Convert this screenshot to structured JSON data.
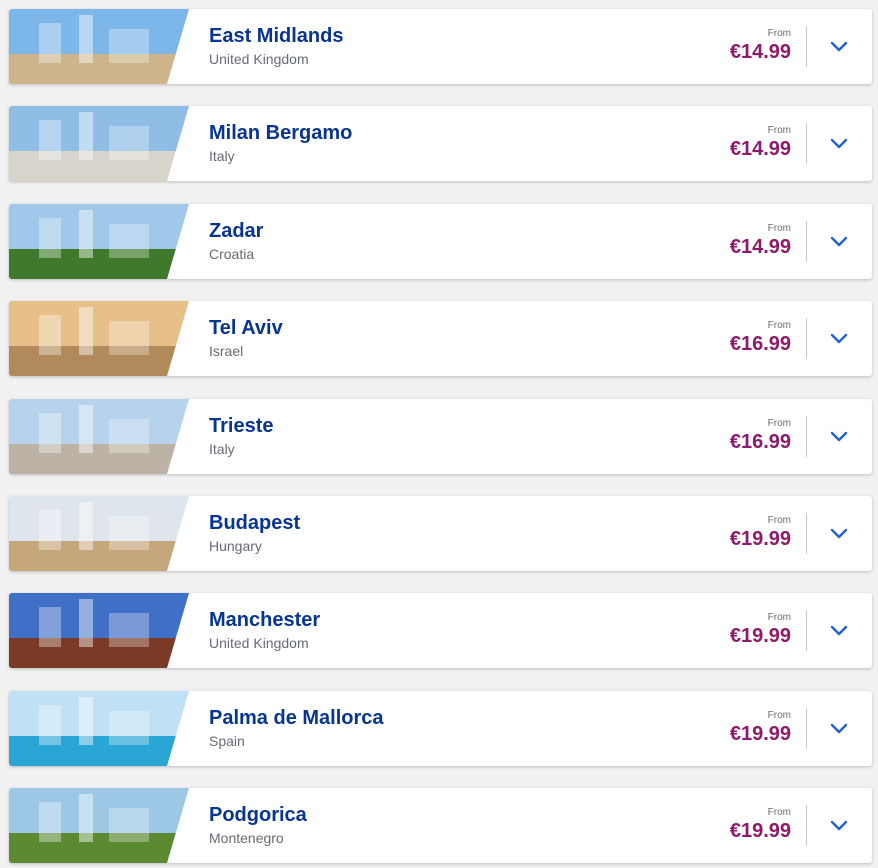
{
  "accent_colors": {
    "city": "#073590",
    "price": "#8d1a6b",
    "chevron": "#1f62d0",
    "background": "#f1f1f1"
  },
  "destinations": [
    {
      "city": "East Midlands",
      "country": "United Kingdom",
      "from_label": "From",
      "price": "€14.99",
      "image": "landmark-tower",
      "sky": "#7db6e8",
      "ground": "#cdb48a"
    },
    {
      "city": "Milan Bergamo",
      "country": "Italy",
      "from_label": "From",
      "price": "€14.99",
      "image": "gothic-cathedral",
      "sky": "#8fbde6",
      "ground": "#d8d4cc"
    },
    {
      "city": "Zadar",
      "country": "Croatia",
      "from_label": "From",
      "price": "€14.99",
      "image": "villa-in-trees",
      "sky": "#9fc8ea",
      "ground": "#3f7a2c"
    },
    {
      "city": "Tel Aviv",
      "country": "Israel",
      "from_label": "From",
      "price": "€16.99",
      "image": "beach-promenade",
      "sky": "#e7c089",
      "ground": "#b08a5a"
    },
    {
      "city": "Trieste",
      "country": "Italy",
      "from_label": "From",
      "price": "€16.99",
      "image": "piazza-palace",
      "sky": "#b7d2ec",
      "ground": "#bdb3a4"
    },
    {
      "city": "Budapest",
      "country": "Hungary",
      "from_label": "From",
      "price": "€19.99",
      "image": "fishermans-bastion",
      "sky": "#dfe5ec",
      "ground": "#c6a77c"
    },
    {
      "city": "Manchester",
      "country": "United Kingdom",
      "from_label": "From",
      "price": "€19.99",
      "image": "town-hall",
      "sky": "#3f6fc6",
      "ground": "#7a3a26"
    },
    {
      "city": "Palma de Mallorca",
      "country": "Spain",
      "from_label": "From",
      "price": "€19.99",
      "image": "coastal-bay",
      "sky": "#bfe0f5",
      "ground": "#2aa6d6"
    },
    {
      "city": "Podgorica",
      "country": "Montenegro",
      "from_label": "From",
      "price": "€19.99",
      "image": "river-canyon",
      "sky": "#9cc8e6",
      "ground": "#5c8a33"
    }
  ],
  "chevron_icon": "chevron-down-icon"
}
